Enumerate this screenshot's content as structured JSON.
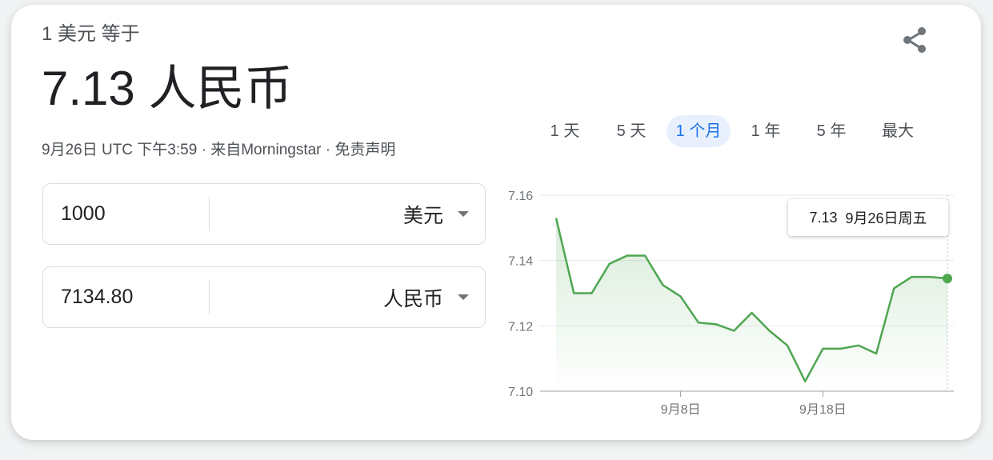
{
  "header": {
    "subtitle": "1 美元 等于",
    "headline": "7.13 人民币",
    "timestamp": "9月26日 UTC 下午3:59",
    "separator": " · ",
    "source_link": "来自Morningstar",
    "disclaimer_link": "免责声明",
    "share_icon": "share-icon"
  },
  "converter": {
    "from": {
      "amount": "1000",
      "currency": "美元"
    },
    "to": {
      "amount": "7134.80",
      "currency": "人民币"
    }
  },
  "range_tabs": [
    {
      "label": "1 天",
      "active": false
    },
    {
      "label": "5 天",
      "active": false
    },
    {
      "label": "1 个月",
      "active": true
    },
    {
      "label": "1 年",
      "active": false
    },
    {
      "label": "5 年",
      "active": false
    },
    {
      "label": "最大",
      "active": false
    }
  ],
  "tooltip": {
    "value": "7.13",
    "date": "9月26日周五"
  },
  "colors": {
    "line": "#4ea651",
    "accent": "#1a73e8",
    "card": "#ffffff"
  },
  "chart_data": {
    "type": "area",
    "x_days": [
      1,
      2,
      3,
      4,
      5,
      6,
      7,
      8,
      9,
      10,
      11,
      12,
      13,
      14,
      15,
      16,
      17,
      18,
      19,
      20,
      21,
      22,
      23
    ],
    "values": [
      7.153,
      7.13,
      7.13,
      7.139,
      7.1415,
      7.1415,
      7.1325,
      7.129,
      7.121,
      7.1205,
      7.1185,
      7.124,
      7.1185,
      7.114,
      7.103,
      7.113,
      7.113,
      7.114,
      7.1115,
      7.1315,
      7.135,
      7.135,
      7.1345
    ],
    "x_ticks": [
      {
        "pos": 8,
        "label": "9月8日"
      },
      {
        "pos": 16,
        "label": "9月18日"
      }
    ],
    "y_ticks": [
      "7.16",
      "7.14",
      "7.12",
      "7.10"
    ],
    "ylim": [
      7.1,
      7.16
    ],
    "grid": true,
    "highlight_last_point": true
  }
}
